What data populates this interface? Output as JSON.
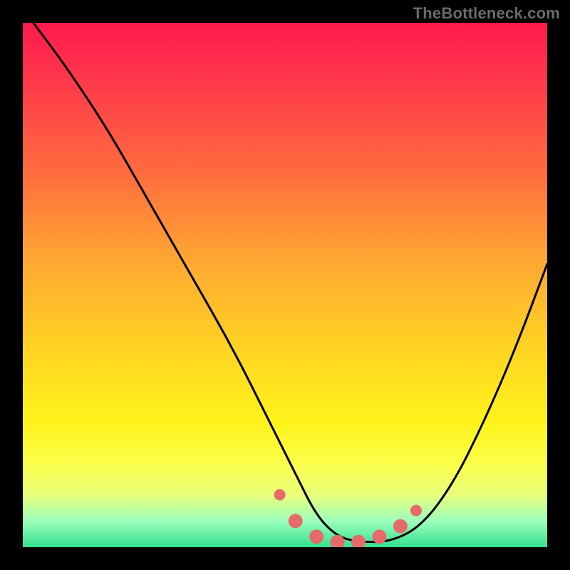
{
  "watermark": "TheBottleneck.com",
  "chart_data": {
    "type": "line",
    "title": "",
    "xlabel": "",
    "ylabel": "",
    "xlim": [
      0,
      100
    ],
    "ylim": [
      0,
      100
    ],
    "series": [
      {
        "name": "bottleneck-curve",
        "x": [
          2,
          8,
          16,
          24,
          32,
          40,
          47,
          52,
          56,
          60,
          64,
          70,
          76,
          82,
          88,
          94,
          100
        ],
        "values": [
          100,
          92,
          80,
          66,
          52,
          38,
          24,
          14,
          6,
          2,
          1,
          1,
          4,
          12,
          24,
          38,
          54
        ]
      }
    ],
    "markers": {
      "name": "sweet-spot",
      "color": "#e76a6a",
      "x": [
        49,
        52,
        56,
        60,
        64,
        68,
        72,
        75
      ],
      "values": [
        10,
        5,
        2,
        1,
        1,
        2,
        4,
        7
      ]
    },
    "gradient_stops": [
      {
        "pos": 0.0,
        "color": "#ff1a4d"
      },
      {
        "pos": 0.28,
        "color": "#ff6a3f"
      },
      {
        "pos": 0.62,
        "color": "#ffd323"
      },
      {
        "pos": 0.84,
        "color": "#fbff4a"
      },
      {
        "pos": 1.0,
        "color": "#33e090"
      }
    ]
  }
}
